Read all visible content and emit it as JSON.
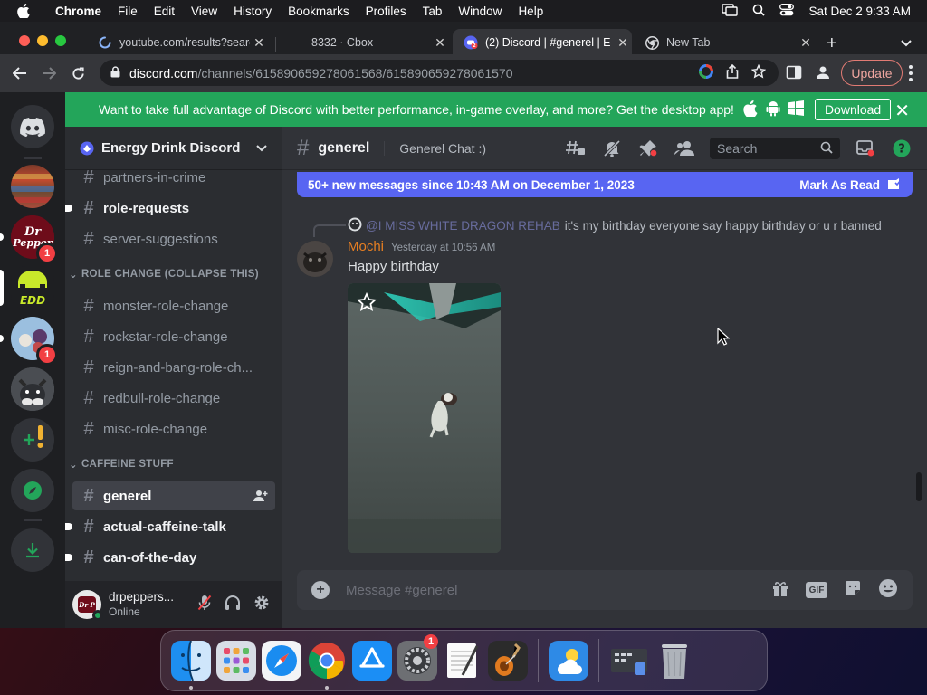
{
  "menubar": {
    "app_name": "Chrome",
    "items": [
      "File",
      "Edit",
      "View",
      "History",
      "Bookmarks",
      "Profiles",
      "Tab",
      "Window",
      "Help"
    ],
    "clock": "Sat Dec 2  9:33 AM"
  },
  "browser": {
    "tabs": [
      {
        "title": "youtube.com/results?search",
        "favicon": "loading-spinner-icon"
      },
      {
        "title": "8332 · Cbox",
        "favicon": "none"
      },
      {
        "title": "(2) Discord | #generel | E",
        "favicon": "discord-icon"
      },
      {
        "title": "New Tab",
        "favicon": "chrome-icon"
      }
    ],
    "active_tab_index": 2,
    "url_host": "discord.com",
    "url_path": "/channels/615890659278061568/615890659278061570",
    "update_label": "Update"
  },
  "banner": {
    "text": "Want to take full advantage of Discord with better performance, in-game overlay, and more? Get the desktop app!",
    "download_label": "Download",
    "color": "#23a55a"
  },
  "guilds": {
    "badges": [
      "1",
      "1"
    ]
  },
  "server": {
    "name": "Energy Drink Discord"
  },
  "channels": {
    "top": [
      {
        "name": "partners-in-crime",
        "state": "normal"
      },
      {
        "name": "role-requests",
        "state": "unread"
      },
      {
        "name": "server-suggestions",
        "state": "normal"
      }
    ],
    "category_role": "ROLE CHANGE (COLLAPSE THIS)",
    "role": [
      {
        "name": "monster-role-change",
        "state": "normal"
      },
      {
        "name": "rockstar-role-change",
        "state": "normal"
      },
      {
        "name": "reign-and-bang-role-ch...",
        "state": "normal"
      },
      {
        "name": "redbull-role-change",
        "state": "normal"
      },
      {
        "name": "misc-role-change",
        "state": "normal"
      }
    ],
    "category_caffeine": "CAFFEINE STUFF",
    "caffeine": [
      {
        "name": "generel",
        "state": "selected"
      },
      {
        "name": "actual-caffeine-talk",
        "state": "unread"
      },
      {
        "name": "can-of-the-day",
        "state": "unread"
      }
    ]
  },
  "user": {
    "name": "drpeppers...",
    "status": "Online"
  },
  "channel": {
    "name": "generel",
    "topic": "Generel Chat :)",
    "search_placeholder": "Search"
  },
  "new_messages": {
    "text": "50+ new messages since 10:43 AM on December 1, 2023",
    "mark_label": "Mark As Read",
    "color": "#5865f2"
  },
  "message": {
    "reply_mention": "@I MISS WHITE DRAGON REHAB",
    "reply_text": "it's my birthday everyone say happy birthday or u r banned",
    "author": "Mochi",
    "author_color": "#e67e22",
    "timestamp": "Yesterday at 10:56 AM",
    "text": "Happy birthday"
  },
  "composer": {
    "placeholder": "Message #generel",
    "gif_label": "GIF"
  },
  "dock": {
    "apps": [
      "finder-icon",
      "launchpad-icon",
      "safari-icon",
      "chrome-icon",
      "app-store-icon",
      "system-settings-icon",
      "textedit-icon",
      "garageband-icon",
      "weather-icon",
      "screenshot-icon",
      "trash-icon"
    ],
    "settings_badge": "1"
  }
}
